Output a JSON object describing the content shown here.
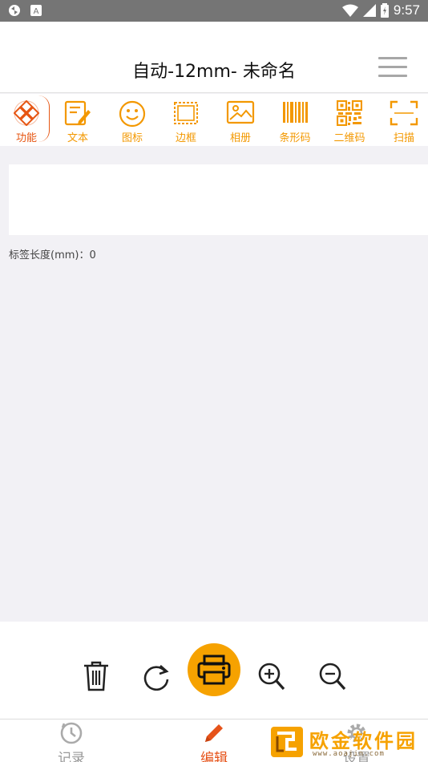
{
  "status_bar": {
    "time": "9:57"
  },
  "header": {
    "title": "自动-12mm- 未命名"
  },
  "toolbar": {
    "items": [
      {
        "label": "功能",
        "icon": "function-icon"
      },
      {
        "label": "文本",
        "icon": "text-edit-icon"
      },
      {
        "label": "图标",
        "icon": "smiley-icon"
      },
      {
        "label": "边框",
        "icon": "border-icon"
      },
      {
        "label": "相册",
        "icon": "photo-icon"
      },
      {
        "label": "条形码",
        "icon": "barcode-icon"
      },
      {
        "label": "二维码",
        "icon": "qrcode-icon"
      },
      {
        "label": "扫描",
        "icon": "scan-icon"
      }
    ]
  },
  "canvas": {
    "label_length": "标签长度(mm)：0"
  },
  "actions": [
    "delete-icon",
    "rotate-icon",
    "print-icon",
    "zoom-in-icon",
    "zoom-out-icon"
  ],
  "tabs": [
    {
      "label": "记录",
      "icon": "history-icon"
    },
    {
      "label": "编辑",
      "icon": "pencil-icon",
      "active": true
    },
    {
      "label": "设置",
      "icon": "gear-icon"
    }
  ],
  "watermark": {
    "text": "欧金软件园",
    "subtext": "www.aoajin.com"
  },
  "colors": {
    "accent": "#f39800",
    "active": "#e65512",
    "print": "#f6a200"
  }
}
